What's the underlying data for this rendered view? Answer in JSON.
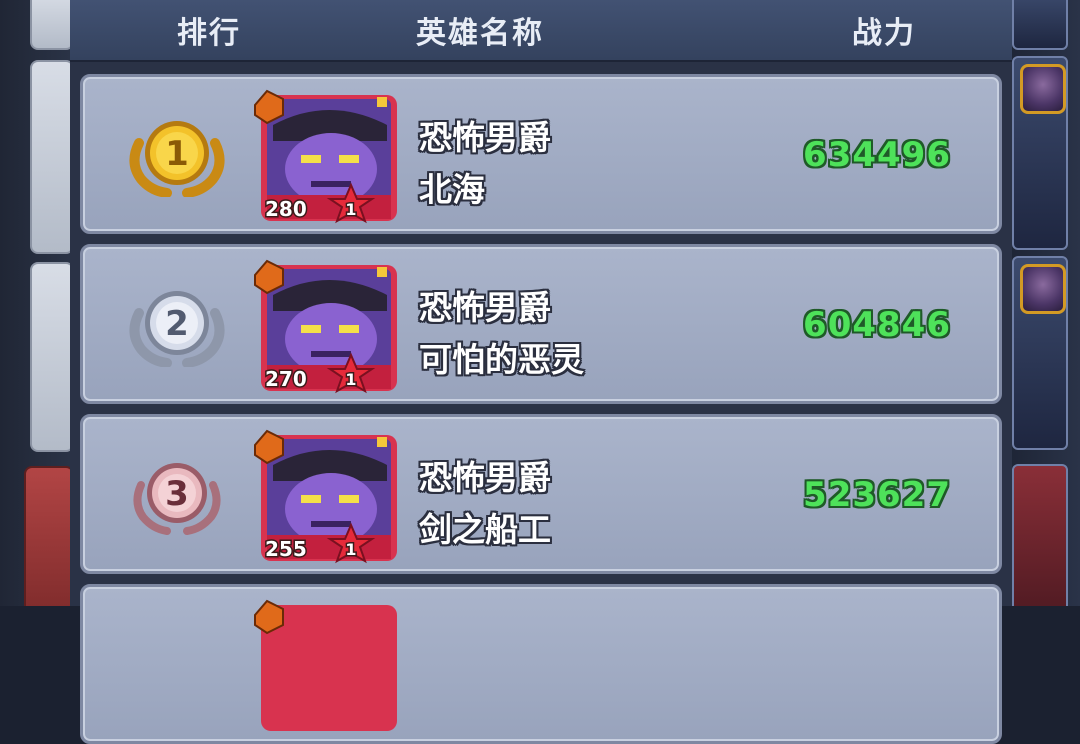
{
  "header": {
    "rank_label": "排行",
    "hero_name_label": "英雄名称",
    "power_label": "战力"
  },
  "rows": [
    {
      "rank": "1",
      "medal": "gold-medal",
      "level": "280",
      "star": "1",
      "hero": "恐怖男爵",
      "player": "北海",
      "power": "634496"
    },
    {
      "rank": "2",
      "medal": "silver-medal",
      "level": "270",
      "star": "1",
      "hero": "恐怖男爵",
      "player": "可怕的恶灵",
      "power": "604846"
    },
    {
      "rank": "3",
      "medal": "bronze-medal",
      "level": "255",
      "star": "1",
      "hero": "恐怖男爵",
      "player": "剑之船工",
      "power": "523627"
    }
  ],
  "colors": {
    "power_text": "#4ee25a",
    "row_bg": "#a3adc5",
    "header_bg": "#3c4a69",
    "portrait_frame": "#d8334f"
  }
}
